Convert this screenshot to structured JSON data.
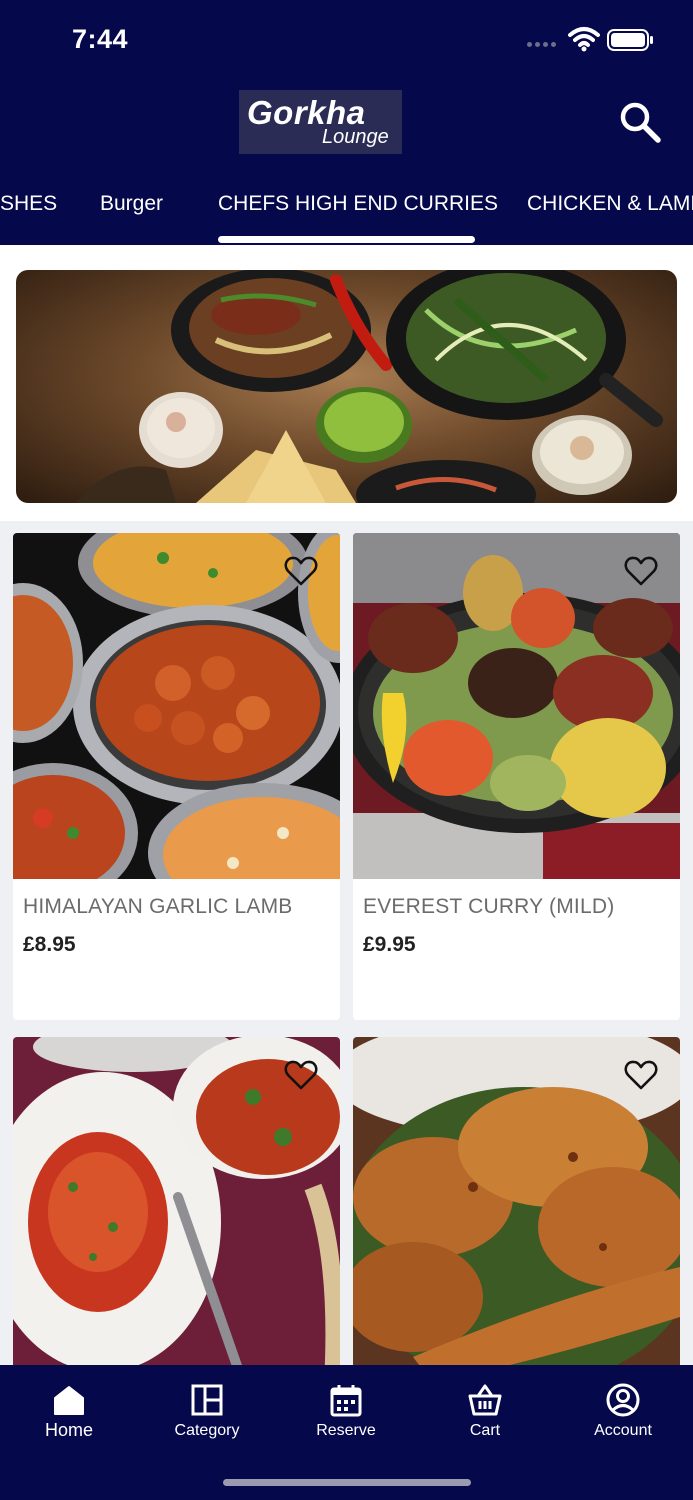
{
  "status_bar": {
    "time": "7:44"
  },
  "header": {
    "logo_main": "Gorkha",
    "logo_sub": "Lounge"
  },
  "tabs": [
    {
      "label": "SHES"
    },
    {
      "label": "Burger"
    },
    {
      "label": "CHEFS HIGH END CURRIES",
      "active": true
    },
    {
      "label": "CHICKEN & LAMB"
    }
  ],
  "products": [
    {
      "name": "HIMALAYAN GARLIC LAMB",
      "price": "£8.95"
    },
    {
      "name": "EVEREST CURRY (MILD)",
      "price": "£9.95"
    },
    {
      "name": "",
      "price": ""
    },
    {
      "name": "",
      "price": ""
    }
  ],
  "bottom_nav": {
    "items": [
      {
        "label": "Home",
        "icon": "home-icon",
        "active": true
      },
      {
        "label": "Category",
        "icon": "category-icon"
      },
      {
        "label": "Reserve",
        "icon": "calendar-icon"
      },
      {
        "label": "Cart",
        "icon": "basket-icon"
      },
      {
        "label": "Account",
        "icon": "account-icon"
      }
    ]
  },
  "colors": {
    "header_bg": "#05084a",
    "page_bg": "#eff0f4"
  }
}
